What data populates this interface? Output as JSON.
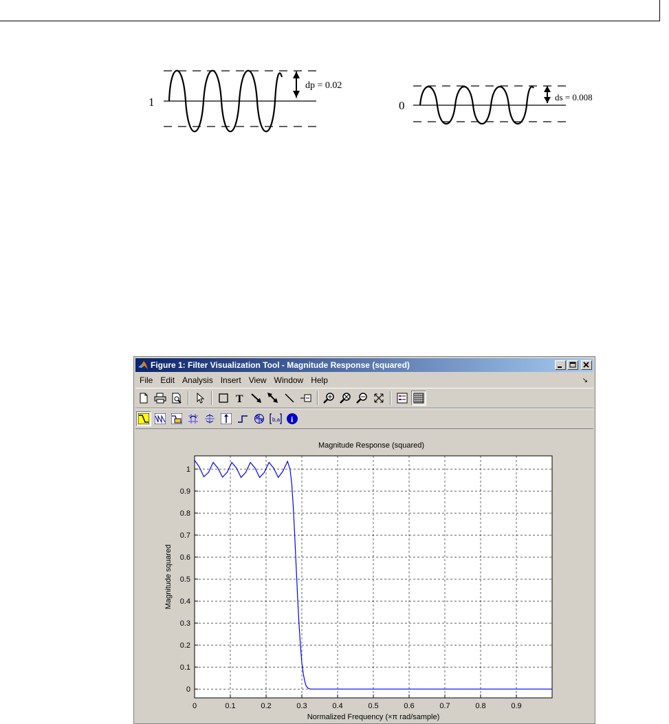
{
  "passband_ripple": {
    "level_label": "1",
    "ripple_label": "dp = 0.02"
  },
  "stopband_ripple": {
    "level_label": "0",
    "ripple_label": "ds = 0.008"
  },
  "window": {
    "title": "Figure 1: Filter Visualization Tool - Magnitude Response (squared)",
    "menu": [
      "File",
      "Edit",
      "Analysis",
      "Insert",
      "View",
      "Window",
      "Help"
    ],
    "toolbar1": [
      "new-figure-icon",
      "print-icon",
      "print-preview-icon",
      "select-arrow-icon",
      "rectangle-icon",
      "text-icon",
      "arrow-icon",
      "double-arrow-icon",
      "line-icon",
      "legend-icon",
      "zoom-in-icon",
      "zoom-out-icon",
      "zoom-x-icon",
      "full-view-icon",
      "legend-toggle-icon",
      "grid-icon"
    ],
    "toolbar2": [
      "magnitude-response-icon",
      "phase-response-icon",
      "magnitude-phase-icon",
      "group-delay-icon",
      "phase-delay-icon",
      "impulse-response-icon",
      "step-response-icon",
      "pole-zero-icon",
      "filter-coefficients-icon",
      "filter-info-icon"
    ],
    "accent_color": "#0a246a"
  },
  "chart_data": {
    "type": "line",
    "title": "Magnitude Response (squared)",
    "xlabel": "Normalized Frequency (×π rad/sample)",
    "ylabel": "Magnitude squared",
    "xlim": [
      0,
      1
    ],
    "ylim": [
      -0.04,
      1.06
    ],
    "xticks": [
      "0",
      "0.1",
      "0.2",
      "0.3",
      "0.4",
      "0.5",
      "0.6",
      "0.7",
      "0.8",
      "0.9"
    ],
    "yticks": [
      "0",
      "0.1",
      "0.2",
      "0.3",
      "0.4",
      "0.5",
      "0.6",
      "0.7",
      "0.8",
      "0.9",
      "1"
    ],
    "grid": true,
    "line_color": "#0000ff",
    "series": [
      {
        "x": [
          0,
          0.013,
          0.026,
          0.039,
          0.052,
          0.065,
          0.078,
          0.091,
          0.104,
          0.117,
          0.13,
          0.143,
          0.156,
          0.169,
          0.182,
          0.195,
          0.208,
          0.221,
          0.234,
          0.247,
          0.26,
          0.267,
          0.272,
          0.276,
          0.28,
          0.284,
          0.288,
          0.292,
          0.296,
          0.3,
          0.304,
          0.308,
          0.312,
          0.316,
          0.32,
          0.325,
          0.33,
          0.35,
          0.4,
          0.5,
          0.6,
          0.7,
          0.8,
          0.9,
          1.0
        ],
        "y": [
          1.04,
          1.01,
          0.965,
          0.985,
          1.03,
          1.005,
          0.963,
          0.985,
          1.03,
          1.005,
          0.962,
          0.985,
          1.03,
          1.005,
          0.962,
          0.985,
          1.03,
          1.005,
          0.962,
          0.99,
          1.035,
          1.0,
          0.93,
          0.83,
          0.7,
          0.56,
          0.42,
          0.3,
          0.2,
          0.12,
          0.07,
          0.035,
          0.015,
          0.006,
          0.002,
          0.0,
          0.0,
          0.0,
          0.0,
          0.0,
          0.0,
          0.0,
          0.0,
          0.0,
          0.0
        ]
      }
    ]
  }
}
